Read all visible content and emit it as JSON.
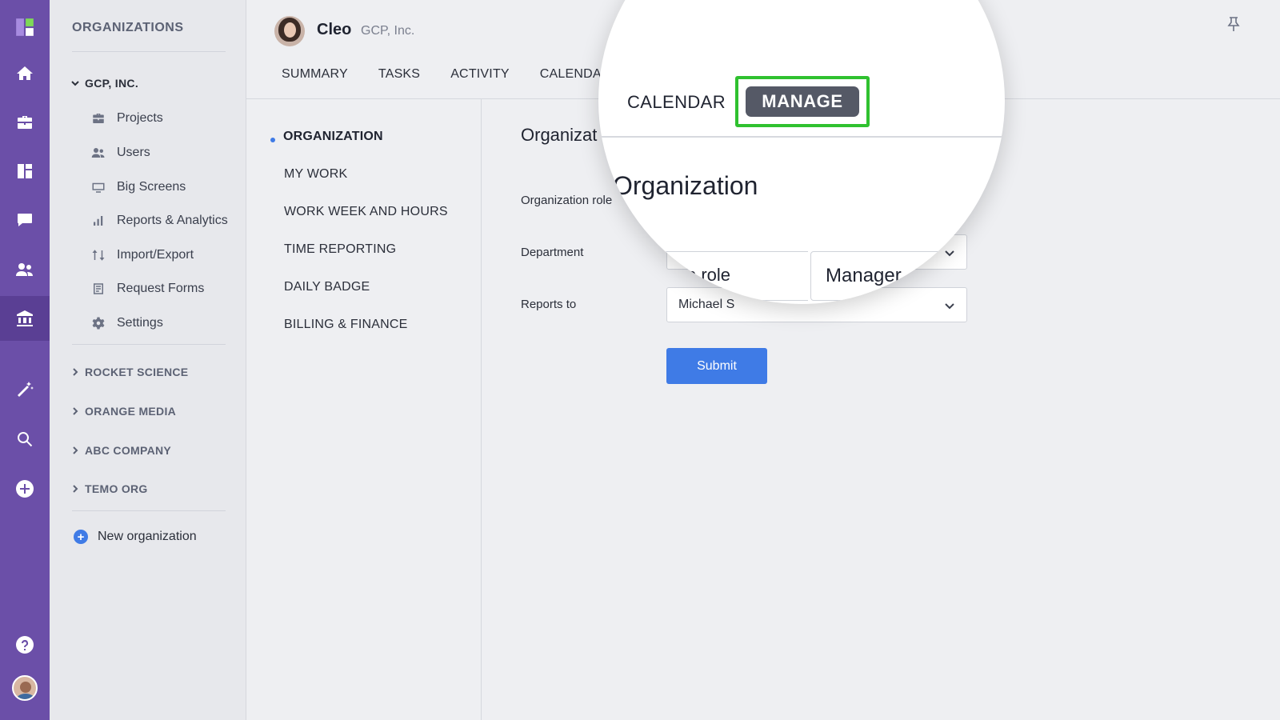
{
  "sidebar": {
    "heading": "ORGANIZATIONS",
    "open_org": "GCP, INC.",
    "items": [
      {
        "label": "Projects",
        "icon": "briefcase-icon"
      },
      {
        "label": "Users",
        "icon": "users-icon"
      },
      {
        "label": "Big Screens",
        "icon": "screen-icon"
      },
      {
        "label": "Reports & Analytics",
        "icon": "bar-chart-icon"
      },
      {
        "label": "Import/Export",
        "icon": "arrows-icon"
      },
      {
        "label": "Request Forms",
        "icon": "form-icon"
      },
      {
        "label": "Settings",
        "icon": "gear-icon"
      }
    ],
    "other_orgs": [
      "ROCKET SCIENCE",
      "ORANGE MEDIA",
      "ABC COMPANY",
      "TEMO ORG"
    ],
    "new_org_label": "New organization"
  },
  "header": {
    "user_name": "Cleo",
    "user_company": "GCP, Inc.",
    "tabs": [
      "SUMMARY",
      "TASKS",
      "ACTIVITY",
      "CALENDAR"
    ]
  },
  "settings_nav": {
    "items": [
      "ORGANIZATION",
      "MY WORK",
      "WORK WEEK AND HOURS",
      "TIME REPORTING",
      "DAILY BADGE",
      "BILLING & FINANCE"
    ],
    "active": "ORGANIZATION"
  },
  "form": {
    "title": "Organizat",
    "labels": {
      "role": "Organization role",
      "department": "Department",
      "reports_to": "Reports to"
    },
    "reports_to_value": "Michael S",
    "submit_label": "Submit"
  },
  "magnifier": {
    "tab_calendar": "CALENDAR",
    "tab_manage": "MANAGE",
    "title": "Organization",
    "field_text": "n role",
    "select_value": "Manager"
  },
  "colors": {
    "rail": "#6b4fa8",
    "accent": "#3f7be6",
    "highlight": "#2fc12f",
    "manage_button": "#555966"
  }
}
